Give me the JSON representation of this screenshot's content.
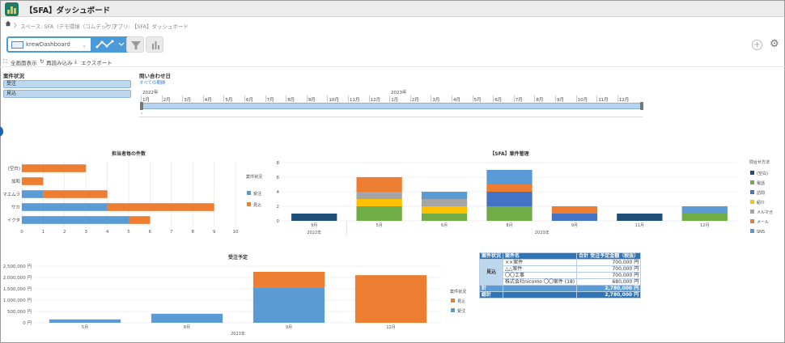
{
  "app": {
    "title": "【SFA】ダッシュボード"
  },
  "breadcrumb": {
    "space": "スペース: SFA（デモ環境（コムデック））",
    "app": "アプリ: 【SFA】ダッシュボード"
  },
  "toolbar": {
    "dashboard_name": "krewDashboard"
  },
  "actions": {
    "fullscreen": "全画面表示",
    "reload": "再読み込み",
    "export": "エクスポート"
  },
  "filter": {
    "status_label": "案件状況",
    "status_items": [
      "受注",
      "見込"
    ],
    "date_label": "問い合わせ日",
    "all_periods": "すべての期間",
    "years": [
      "2022年",
      "2023年"
    ],
    "months_2022": [
      "1月",
      "2月",
      "3月",
      "4月",
      "5月",
      "6月",
      "7月",
      "8月",
      "9月",
      "10月",
      "11月",
      "12月"
    ],
    "months_2023": [
      "1月",
      "2月",
      "3月",
      "4月",
      "5月",
      "6月",
      "7月",
      "8月",
      "9月",
      "10月",
      "11月",
      "12月"
    ],
    "scroll_arrow": "‹"
  },
  "chart_data": [
    {
      "id": "count_by_rep",
      "type": "bar",
      "orientation": "horizontal",
      "stacked": true,
      "title": "担当者毎の件数",
      "categories": [
        "(空白)",
        "加和",
        "マエムラ",
        "サカ",
        "イクタ"
      ],
      "series": [
        {
          "name": "受注",
          "color": "#5b9bd5",
          "values": [
            0,
            0,
            1,
            4,
            5
          ]
        },
        {
          "name": "見込",
          "color": "#ed7d31",
          "values": [
            3,
            1,
            3,
            5,
            1
          ]
        }
      ],
      "xlim": [
        0,
        10
      ],
      "xticks": [
        "0",
        "1",
        "2",
        "3",
        "4",
        "5",
        "6",
        "7",
        "8",
        "9",
        "10"
      ],
      "legend_title": "案件状況",
      "legend_position": "right",
      "grid": true
    },
    {
      "id": "sfa_cases",
      "type": "bar",
      "stacked": true,
      "title": "【SFA】案件管理",
      "categories": [
        "9月",
        "5月",
        "6月",
        "8月",
        "9月",
        "11月",
        "12月"
      ],
      "year_groups": [
        {
          "label": "2022年",
          "span": 1
        },
        {
          "label": "2023年",
          "span": 6
        }
      ],
      "series": [
        {
          "name": "(空白)",
          "color": "#1f4e79",
          "values": [
            1,
            0,
            0,
            0,
            0,
            1,
            0
          ]
        },
        {
          "name": "電話",
          "color": "#70ad47",
          "values": [
            0,
            2,
            1,
            2,
            0,
            0,
            1
          ]
        },
        {
          "name": "訪問",
          "color": "#4472c4",
          "values": [
            0,
            0,
            0,
            2,
            1,
            0,
            0
          ]
        },
        {
          "name": "紹介",
          "color": "#ffc000",
          "values": [
            0,
            1,
            1,
            0,
            0,
            0,
            0
          ]
        },
        {
          "name": "メルマガ",
          "color": "#a5a5a5",
          "values": [
            0,
            1,
            1,
            0,
            0,
            0,
            0
          ]
        },
        {
          "name": "メール",
          "color": "#ed7d31",
          "values": [
            0,
            2,
            0,
            1,
            1,
            0,
            0
          ]
        },
        {
          "name": "SNS",
          "color": "#5b9bd5",
          "values": [
            0,
            0,
            1,
            2,
            0,
            0,
            1
          ]
        }
      ],
      "ylim": [
        0,
        8
      ],
      "yticks": [
        "0",
        "2",
        "4",
        "6",
        "8"
      ],
      "legend_title": "問合せ方法",
      "legend_position": "right",
      "grid": true
    },
    {
      "id": "order_forecast",
      "type": "bar",
      "stacked": true,
      "title": "受注予定",
      "categories": [
        "5月",
        "8月",
        "9月",
        "12月"
      ],
      "year_groups": [
        {
          "label": "2023年",
          "span": 4
        }
      ],
      "series": [
        {
          "name": "受注",
          "color": "#5b9bd5",
          "values": [
            150000,
            400000,
            1550000,
            0
          ]
        },
        {
          "name": "見込",
          "color": "#ed7d31",
          "values": [
            0,
            0,
            700000,
            2100000
          ]
        }
      ],
      "ylim": [
        0,
        2500000
      ],
      "yticks": [
        "0 円",
        "500,000 円",
        "1,000,000 円",
        "1,500,000 円",
        "2,000,000 円",
        "2,500,000 円"
      ],
      "legend_title": "案件状況",
      "legend_order": [
        "見込",
        "受注"
      ],
      "legend_position": "right",
      "grid": true
    }
  ],
  "pivot": {
    "headers": [
      "案件状況",
      "案件名",
      "合計 受注予定金額（税抜）"
    ],
    "status": "見込",
    "rows": [
      {
        "name": "××案件",
        "amount": "700,000 円"
      },
      {
        "name": "△△案件",
        "amount": "700,000 円"
      },
      {
        "name": "〇〇工事",
        "amount": "700,000 円"
      },
      {
        "name": "株式会社nicomo 〇〇案件 (18)",
        "amount": "680,000 円"
      }
    ],
    "subtotal_label": "計",
    "subtotal": "2,780,000 円",
    "total_label": "総計",
    "total": "2,780,000 円"
  },
  "colors": {
    "accent": "#4a9ad8",
    "header_bg": "#ececec",
    "slider": "#b6d4ef"
  }
}
